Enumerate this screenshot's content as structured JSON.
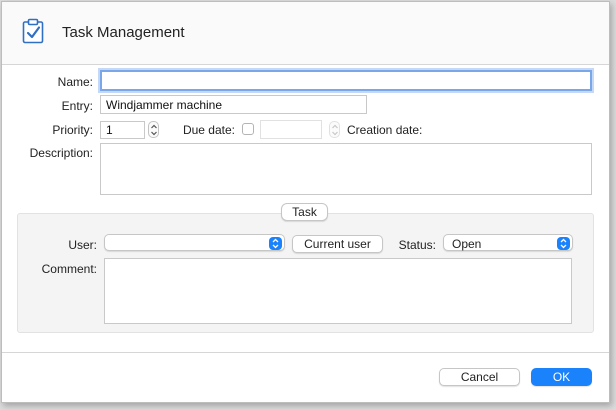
{
  "header": {
    "title": "Task Management",
    "icon": "clipboard-check-icon"
  },
  "form": {
    "name_label": "Name:",
    "name_value": "",
    "entry_label": "Entry:",
    "entry_value": "Windjammer machine",
    "priority_label": "Priority:",
    "priority_value": "1",
    "due_date_label": "Due date:",
    "due_date_checked": false,
    "due_date_value": "",
    "creation_date_label": "Creation date:",
    "creation_date_value": "",
    "description_label": "Description:",
    "description_value": ""
  },
  "task_panel": {
    "title": "Task",
    "user_label": "User:",
    "user_value": "",
    "current_user_label": "Current user",
    "status_label": "Status:",
    "status_value": "Open",
    "comment_label": "Comment:",
    "comment_value": ""
  },
  "footer": {
    "cancel_label": "Cancel",
    "ok_label": "OK"
  },
  "colors": {
    "accent": "#1a82fb",
    "focus_ring": "#7aa7ea",
    "icon": "#2f6fc4"
  }
}
